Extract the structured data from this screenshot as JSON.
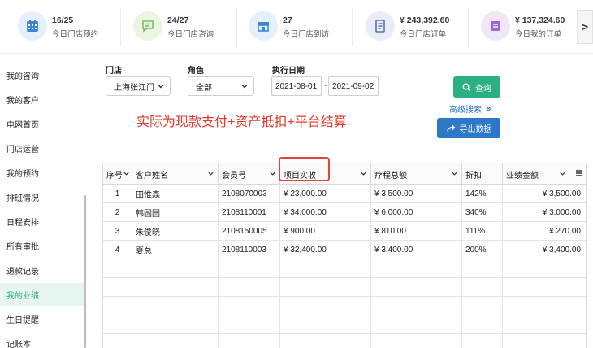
{
  "stats": [
    {
      "icon": "calendar-icon",
      "value": "16/25",
      "label": "今日门店预约",
      "bg": "#e4f0fb",
      "color": "#3d86d6"
    },
    {
      "icon": "chat-icon",
      "value": "24/27",
      "label": "今日门店咨询",
      "bg": "#eaf6e2",
      "color": "#7bbf5d"
    },
    {
      "icon": "store-icon",
      "value": "27",
      "label": "今日门店到访",
      "bg": "#e4f0fb",
      "color": "#3d86d6"
    },
    {
      "icon": "document-icon",
      "value": "¥ 243,392.60",
      "label": "今日门店订单",
      "bg": "#e8ecf7",
      "color": "#5a6fb6"
    },
    {
      "icon": "note-icon",
      "value": "¥ 137,324.60",
      "label": "今日我的订单",
      "bg": "#efe6f7",
      "color": "#9a6ac8"
    }
  ],
  "next_label": ">",
  "sidebar": {
    "items": [
      {
        "label": "我的咨询",
        "active": false
      },
      {
        "label": "我的客户",
        "active": false
      },
      {
        "label": "电网首页",
        "active": false
      },
      {
        "label": "门店运营",
        "active": false
      },
      {
        "label": "我的预约",
        "active": false
      },
      {
        "label": "排班情况",
        "active": false
      },
      {
        "label": "日程安排",
        "active": false
      },
      {
        "label": "所有审批",
        "active": false
      },
      {
        "label": "退款记录",
        "active": false
      },
      {
        "label": "我的业绩",
        "active": true
      },
      {
        "label": "生日提醒",
        "active": false
      },
      {
        "label": "记账本",
        "active": false
      }
    ]
  },
  "filters": {
    "store_label": "门店",
    "store_value": "上海张江门",
    "role_label": "角色",
    "role_value": "全部",
    "date_label": "执行日期",
    "date_from": "2021-08-01",
    "date_sep": "-",
    "date_to": "2021-09-02"
  },
  "actions": {
    "query_label": "查询",
    "advanced_label": "高级搜索",
    "export_label": "导出数据"
  },
  "annotation": "实际为现款支付+资产抵扣+平台结算",
  "table": {
    "headers": [
      "序号",
      "客户姓名",
      "会员号",
      "项目实收",
      "疗程总额",
      "折扣",
      "业绩金额"
    ],
    "rows": [
      [
        "1",
        "田惟森",
        "2108070003",
        "¥ 23,000.00",
        "¥ 3,500.00",
        "142%",
        "¥ 3,500.00"
      ],
      [
        "2",
        "韩圆圆",
        "2108110001",
        "¥ 34,000.00",
        "¥ 6,000.00",
        "340%",
        "¥ 3,000.00"
      ],
      [
        "3",
        "朱俊晓",
        "2108150005",
        "¥ 900.00",
        "¥ 810.00",
        "111%",
        "¥ 270.00"
      ],
      [
        "4",
        "夏总",
        "2108110003",
        "¥ 32,400.00",
        "¥ 3,400.00",
        "200%",
        "¥ 3,400.00"
      ]
    ]
  },
  "colors": {
    "accent": "#2cb07f",
    "primary": "#2d78c8",
    "annotation": "#e2392c"
  }
}
